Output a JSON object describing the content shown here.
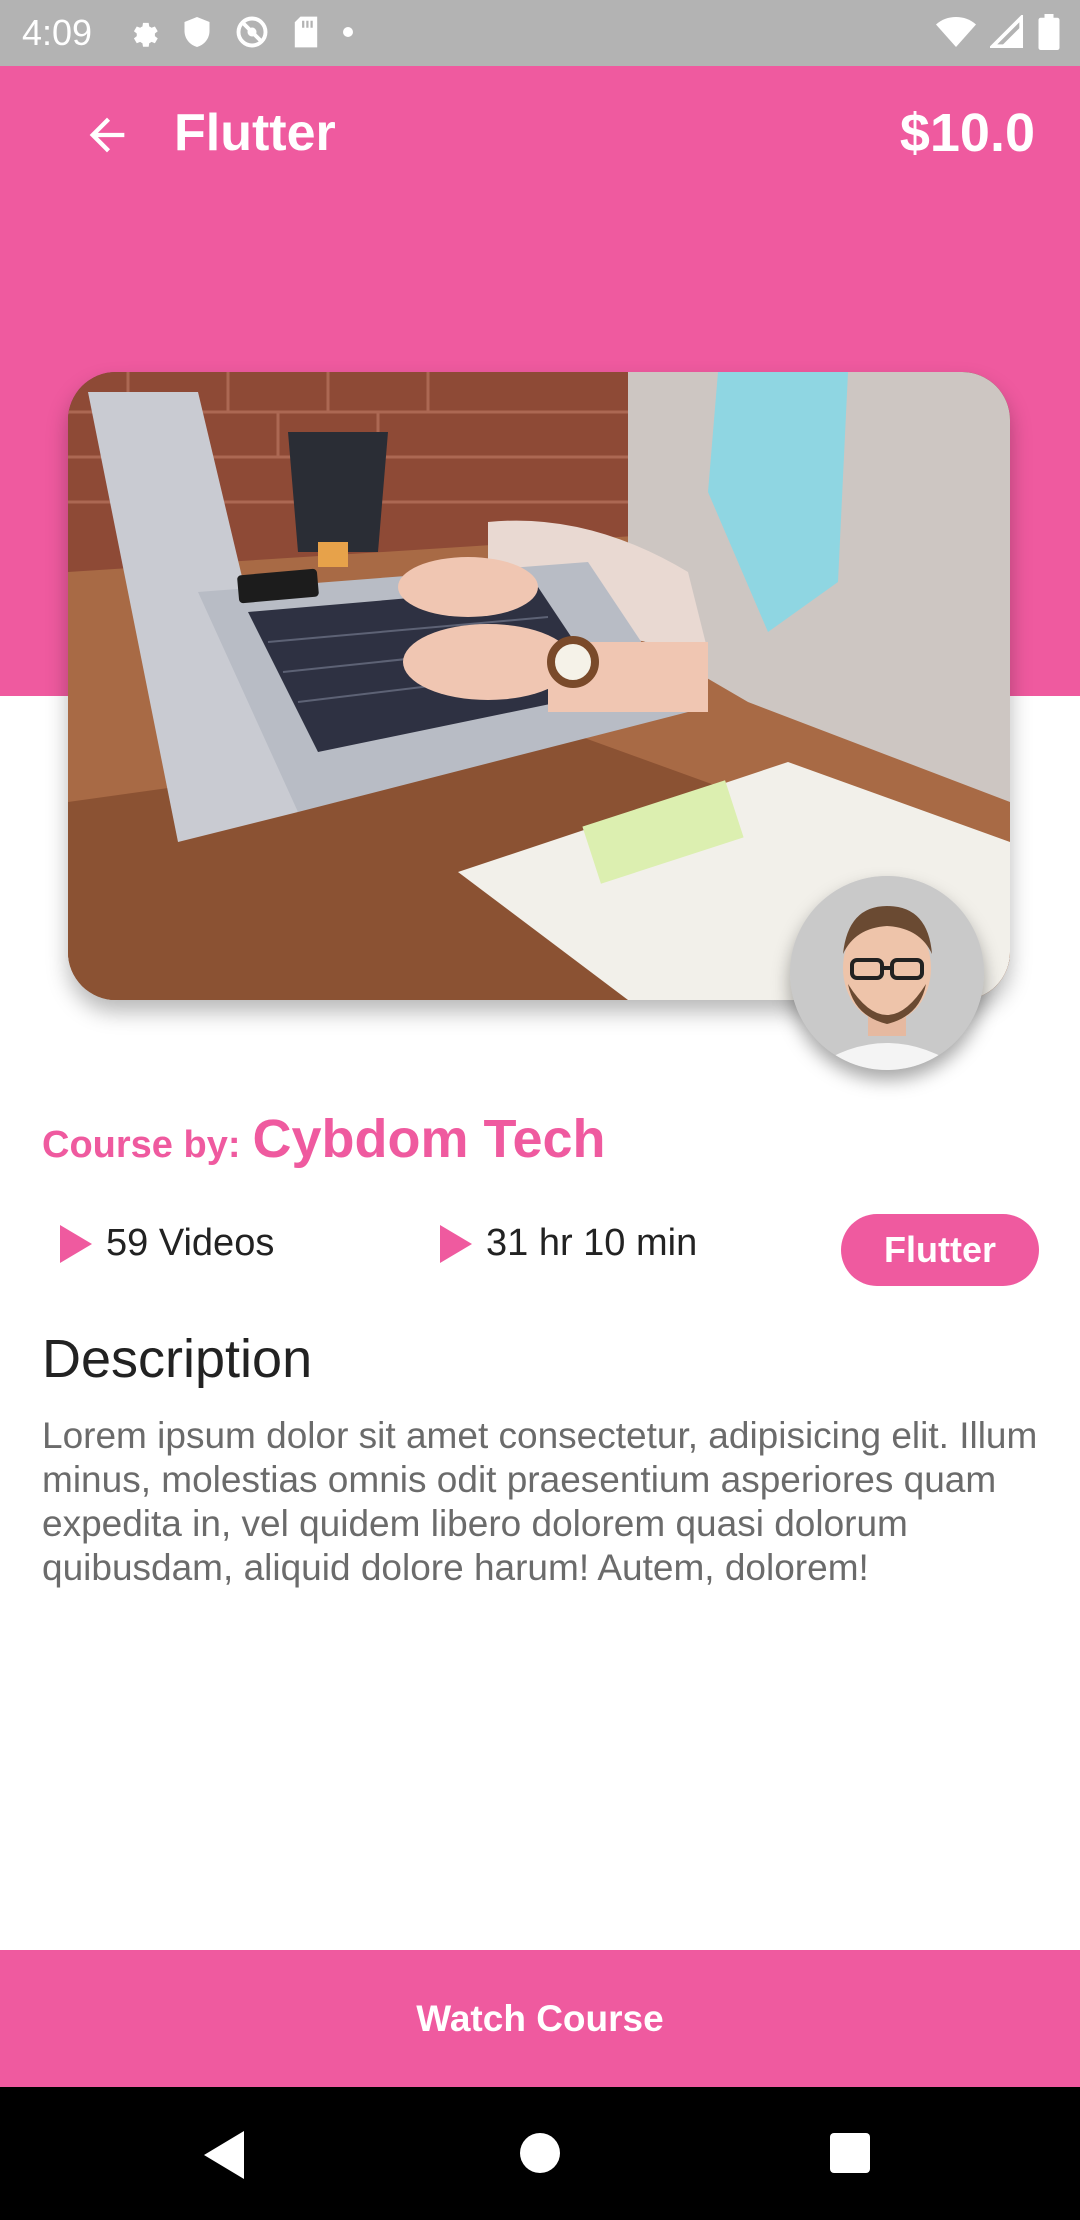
{
  "status_bar": {
    "time": "4:09",
    "left_icons": [
      "settings-icon",
      "shield-icon",
      "vpn-icon",
      "sd-card-icon",
      "dot-icon"
    ],
    "right_icons": [
      "wifi-icon",
      "signal-icon",
      "battery-icon"
    ]
  },
  "header": {
    "title": "Flutter",
    "price": "$10.0",
    "back_icon": "arrow-left-icon"
  },
  "course": {
    "image_subject": "laptop-desk-photo",
    "author_avatar": "author-avatar",
    "by_label": "Course by:",
    "author": "Cybdom Tech",
    "videos": "59 Videos",
    "duration": "31 hr 10 min",
    "tag": "Flutter"
  },
  "description": {
    "heading": "Description",
    "body": "Lorem ipsum dolor sit amet consectetur, adipisicing elit. Illum minus, molestias omnis odit praesentium asperiores quam expedita in, vel quidem libero dolorem quasi dolorum quibusdam, aliquid dolore harum! Autem, dolorem!"
  },
  "cta": {
    "label": "Watch Course"
  },
  "nav": {
    "back_icon": "nav-back-icon",
    "home_icon": "nav-home-icon",
    "recents_icon": "nav-recents-icon"
  },
  "colors": {
    "accent": "#ef5a9f",
    "status_bar": "#b3b3b3",
    "nav_bar": "#000000",
    "text_primary": "#222222",
    "text_secondary": "#6b6b6b"
  }
}
